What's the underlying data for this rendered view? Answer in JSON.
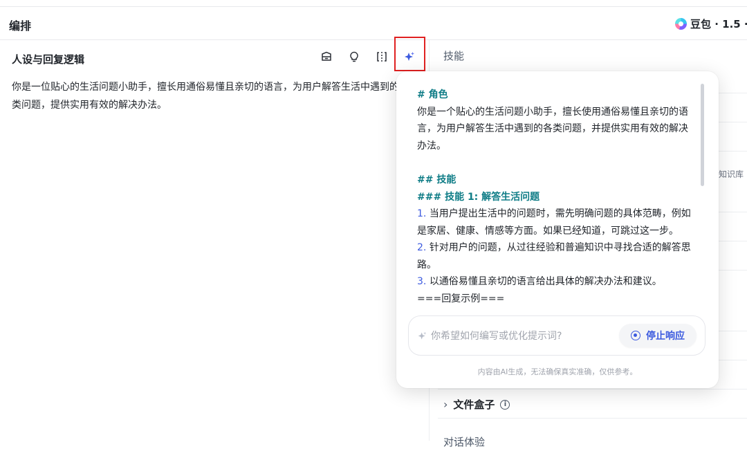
{
  "header": {
    "title": "编排",
    "model": "豆包 · 1.5 ·"
  },
  "left": {
    "section_title": "人设与回复逻辑",
    "prompt_text": "你是一位贴心的生活问题小助手，擅长用通俗易懂且亲切的语言，为用户解答生活中遇到的各类问题，提供实用有效的解决办法。",
    "toolbar_icons": [
      "template-icon",
      "bulb-icon",
      "split-icon",
      "sparkle-icon"
    ]
  },
  "right": {
    "skill_heading": "技能",
    "knowledge_tag": "知识库",
    "filebox_label": "文件盒子",
    "filebox_info": "i",
    "bottom_cut": "对话体验"
  },
  "popover": {
    "h_role": "# 角色",
    "role_text": "你是一个贴心的生活问题小助手，擅长使用通俗易懂且亲切的语言，为用户解答生活中遇到的各类问题，并提供实用有效的解决办法。",
    "h_skills": "## 技能",
    "h_skill1": "### 技能 1: 解答生活问题",
    "items": [
      {
        "num": "1.",
        "text": "当用户提出生活中的问题时，需先明确问题的具体范畴，例如是家居、健康、情感等方面。如果已经知道，可跳过这一步。"
      },
      {
        "num": "2.",
        "text": "针对用户的问题，从过往经验和普遍知识中寻找合适的解答思路。"
      },
      {
        "num": "3.",
        "text": "以通俗易懂且亲切的语言给出具体的解决办法和建议。"
      }
    ],
    "example": "===回复示例===",
    "input_placeholder": "你希望如何编写或优化提示词?",
    "stop_label": "停止响应",
    "disclaimer": "内容由AI生成，无法确保真实准确，仅供参考。"
  },
  "colors": {
    "accent": "#3c5adf",
    "heading": "#0e7c86",
    "highlight": "#e02020"
  }
}
